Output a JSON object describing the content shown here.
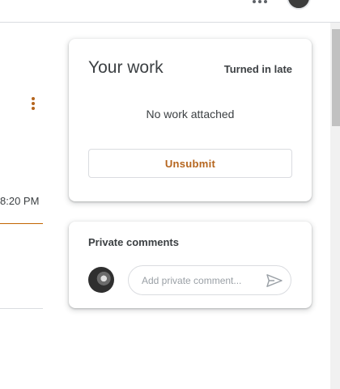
{
  "header": {
    "apps_icon": "apps-more-icon",
    "account_avatar": "account-avatar"
  },
  "assignment": {
    "more_icon": "more-vert-icon",
    "due_time": "8:20 PM"
  },
  "work_card": {
    "title": "Your work",
    "status": "Turned in late",
    "empty_message": "No work attached",
    "unsubmit_label": "Unsubmit"
  },
  "comments_card": {
    "title": "Private comments",
    "placeholder": "Add private comment...",
    "send_icon": "send-icon"
  },
  "colors": {
    "accent": "#b5651d",
    "divider": "#dadce0",
    "text": "#3c4043"
  }
}
